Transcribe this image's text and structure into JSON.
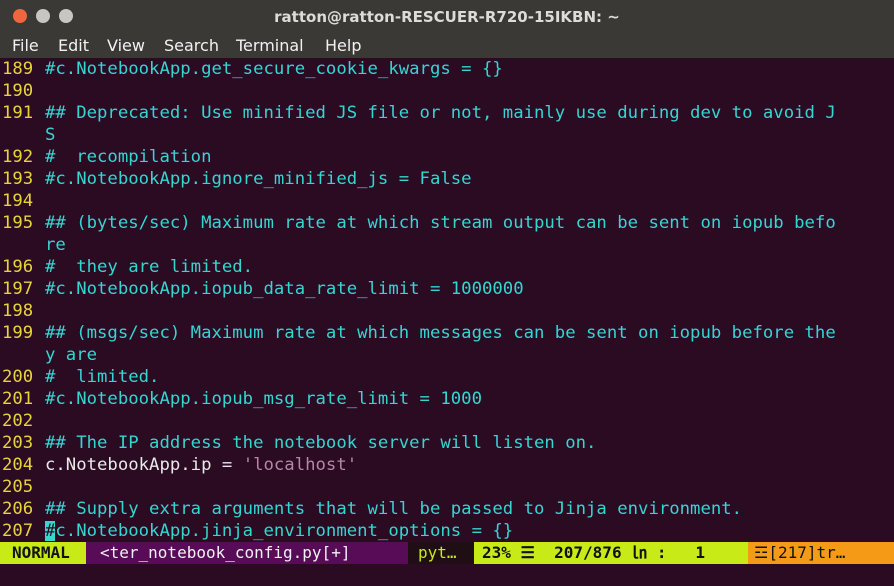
{
  "window": {
    "title": "ratton@ratton-RESCUER-R720-15IKBN: ~",
    "buttons": [
      "close",
      "minimize",
      "maximize"
    ]
  },
  "menubar": {
    "items": [
      "File",
      "Edit",
      "View",
      "Search",
      "Terminal",
      "Help"
    ]
  },
  "editor": {
    "lines": [
      {
        "num": "189",
        "text": "#c.NotebookApp.get_secure_cookie_kwargs = {}",
        "style": "comment"
      },
      {
        "num": "190",
        "text": "",
        "style": "comment"
      },
      {
        "num": "191",
        "text": "## Deprecated: Use minified JS file or not, mainly use during dev to avoid J",
        "style": "comment"
      },
      {
        "num": "",
        "text": "S",
        "style": "comment"
      },
      {
        "num": "192",
        "text": "#  recompilation",
        "style": "comment"
      },
      {
        "num": "193",
        "text": "#c.NotebookApp.ignore_minified_js = False",
        "style": "comment"
      },
      {
        "num": "194",
        "text": "",
        "style": "comment"
      },
      {
        "num": "195",
        "text": "## (bytes/sec) Maximum rate at which stream output can be sent on iopub befo",
        "style": "comment"
      },
      {
        "num": "",
        "text": "re",
        "style": "comment"
      },
      {
        "num": "196",
        "text": "#  they are limited.",
        "style": "comment"
      },
      {
        "num": "197",
        "text": "#c.NotebookApp.iopub_data_rate_limit = 1000000",
        "style": "comment"
      },
      {
        "num": "198",
        "text": "",
        "style": "comment"
      },
      {
        "num": "199",
        "text": "## (msgs/sec) Maximum rate at which messages can be sent on iopub before the",
        "style": "comment"
      },
      {
        "num": "",
        "text": "y are",
        "style": "comment"
      },
      {
        "num": "200",
        "text": "#  limited.",
        "style": "comment"
      },
      {
        "num": "201",
        "text": "#c.NotebookApp.iopub_msg_rate_limit = 1000",
        "style": "comment"
      },
      {
        "num": "202",
        "text": "",
        "style": "comment"
      },
      {
        "num": "203",
        "text": "## The IP address the notebook server will listen on.",
        "style": "comment"
      },
      {
        "num": "204",
        "text": "c.NotebookApp.ip = ",
        "style": "plain",
        "string": "'localhost'"
      },
      {
        "num": "205",
        "text": "",
        "style": "comment"
      },
      {
        "num": "206",
        "text": "## Supply extra arguments that will be passed to Jinja environment.",
        "style": "comment"
      },
      {
        "num": "207",
        "text": "c.NotebookApp.jinja_environment_options = {}",
        "style": "comment",
        "cursor_char": "#"
      }
    ]
  },
  "statusline": {
    "mode": "NORMAL",
    "filename": "<ter_notebook_config.py[+]",
    "filetype": "pyt…",
    "position": "23% ☰  207/876 ㏑ :   1",
    "warnings": "☲[217]tr…"
  },
  "colors": {
    "background": "#2b0b22",
    "comment": "#34d6d2",
    "line_number": "#e8d33c",
    "string": "#b685a7",
    "status_green": "#c8ea16",
    "status_purple": "#580b57",
    "status_orange": "#f59a16"
  }
}
